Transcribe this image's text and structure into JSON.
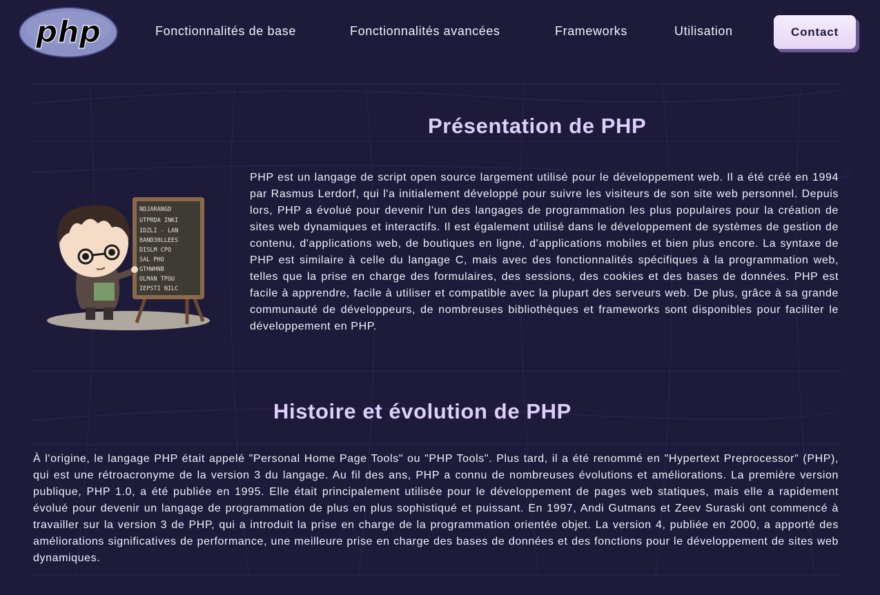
{
  "header": {
    "logo_text": "php",
    "nav": [
      {
        "label": "Fonctionnalités de base"
      },
      {
        "label": "Fonctionnalités avancées"
      },
      {
        "label": "Frameworks"
      },
      {
        "label": "Utilisation"
      }
    ],
    "contact_label": "Contact"
  },
  "presentation": {
    "title": "Présentation de PHP",
    "text": "PHP est un langage de script open source largement utilisé pour le développement web. Il a été créé en 1994 par Rasmus Lerdorf, qui l'a initialement développé pour suivre les visiteurs de son site web personnel. Depuis lors, PHP a évolué pour devenir l'un des langages de programmation les plus populaires pour la création de sites web dynamiques et interactifs. Il est également utilisé dans le développement de systèmes de gestion de contenu, d'applications web, de boutiques en ligne, d'applications mobiles et bien plus encore. La syntaxe de PHP est similaire à celle du langage C, mais avec des fonctionnalités spécifiques à la programmation web, telles que la prise en charge des formulaires, des sessions, des cookies et des bases de données. PHP est facile à apprendre, facile à utiliser et compatible avec la plupart des serveurs web. De plus, grâce à sa grande communauté de développeurs, de nombreuses bibliothèques et frameworks sont disponibles pour faciliter le développement en PHP."
  },
  "history": {
    "title": "Histoire et évolution de PHP",
    "text": "À l'origine, le langage PHP était appelé \"Personal Home Page Tools\" ou \"PHP Tools\". Plus tard, il a été renommé en \"Hypertext Preprocessor\" (PHP), qui est une rétroacronyme de la version 3 du langage. Au fil des ans, PHP a connu de nombreuses évolutions et améliorations. La première version publique, PHP 1.0, a été publiée en 1995. Elle était principalement utilisée pour le développement de pages web statiques, mais elle a rapidement évolué pour devenir un langage de programmation de plus en plus sophistiqué et puissant. En 1997, Andi Gutmans et Zeev Suraski ont commencé à travailler sur la version 3 de PHP, qui a introduit la prise en charge de la programmation orientée objet. La version 4, publiée en 2000, a apporté des améliorations significatives de performance, une meilleure prise en charge des bases de données et des fonctions pour le développement de sites web dynamiques."
  },
  "illustration": {
    "board_lines": [
      "NDJARANGD",
      "UTPRDA INKI",
      "IDZLI - LAN",
      "8AND30LLEES",
      "DISLM CPO",
      "SAL PHO",
      "GTHWHNB",
      "OLMAN TPOU",
      "IEPSTI NILC"
    ]
  },
  "colors": {
    "background": "#1d1a3a",
    "title": "#ddd0fa",
    "text": "#f3f1fb",
    "contact_bg": "#f0e6fb",
    "logo": "#8a8fc4"
  }
}
